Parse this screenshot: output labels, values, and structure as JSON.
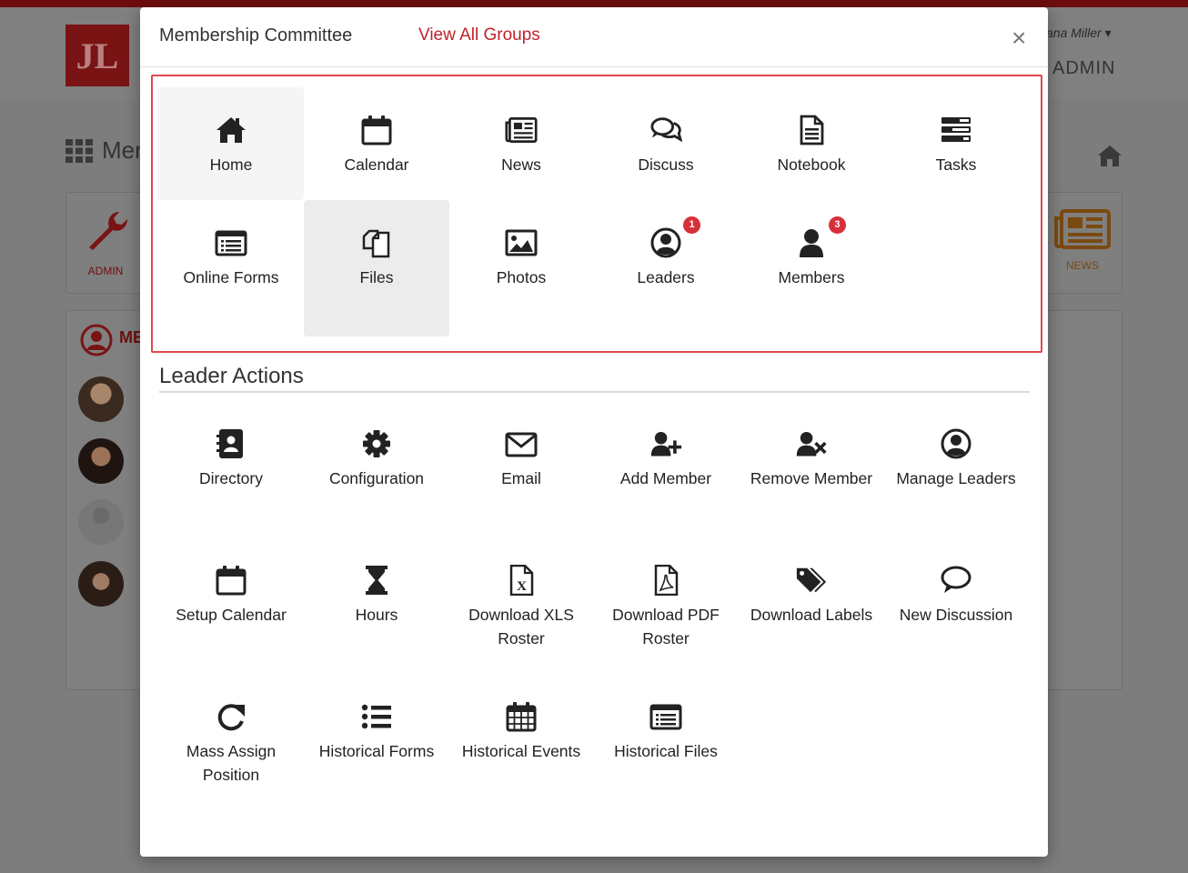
{
  "background": {
    "user_name": "ana Miller",
    "admin_label": "ADMIN",
    "page_title": "Mer",
    "admin_tile_label": "ADMIN",
    "news_tile_label": "NEWS",
    "members_label": "ME"
  },
  "modal": {
    "title": "Membership Committee",
    "view_all_link": "View All Groups",
    "close_glyph": "×"
  },
  "group_nav": [
    {
      "label": "Home",
      "icon": "home-icon"
    },
    {
      "label": "Calendar",
      "icon": "calendar-icon"
    },
    {
      "label": "News",
      "icon": "newspaper-icon"
    },
    {
      "label": "Discuss",
      "icon": "comments-icon"
    },
    {
      "label": "Notebook",
      "icon": "notebook-icon"
    },
    {
      "label": "Tasks",
      "icon": "tasks-icon"
    },
    {
      "label": "Online Forms",
      "icon": "list-form-icon"
    },
    {
      "label": "Files",
      "icon": "files-icon"
    },
    {
      "label": "Photos",
      "icon": "image-icon"
    },
    {
      "label": "Leaders",
      "icon": "user-circle-icon",
      "badge": "1"
    },
    {
      "label": "Members",
      "icon": "user-icon",
      "badge": "3"
    }
  ],
  "leader_actions": {
    "title": "Leader Actions",
    "items": [
      {
        "label": "Directory",
        "icon": "address-book-icon"
      },
      {
        "label": "Configuration",
        "icon": "gear-icon"
      },
      {
        "label": "Email",
        "icon": "envelope-icon"
      },
      {
        "label": "Add Member",
        "icon": "user-plus-icon"
      },
      {
        "label": "Remove Member",
        "icon": "user-times-icon"
      },
      {
        "label": "Manage Leaders",
        "icon": "user-circle-icon"
      },
      {
        "label": "Setup Calendar",
        "icon": "calendar-icon"
      },
      {
        "label": "Hours",
        "icon": "hourglass-icon"
      },
      {
        "label": "Download XLS Roster",
        "icon": "excel-file-icon"
      },
      {
        "label": "Download PDF Roster",
        "icon": "pdf-file-icon"
      },
      {
        "label": "Download Labels",
        "icon": "tags-icon"
      },
      {
        "label": "New Discussion",
        "icon": "comment-icon"
      },
      {
        "label": "Mass Assign Position",
        "icon": "redo-icon"
      },
      {
        "label": "Historical Forms",
        "icon": "list-icon"
      },
      {
        "label": "Historical Events",
        "icon": "calendar-grid-icon"
      },
      {
        "label": "Historical Files",
        "icon": "list-form-icon"
      }
    ]
  }
}
